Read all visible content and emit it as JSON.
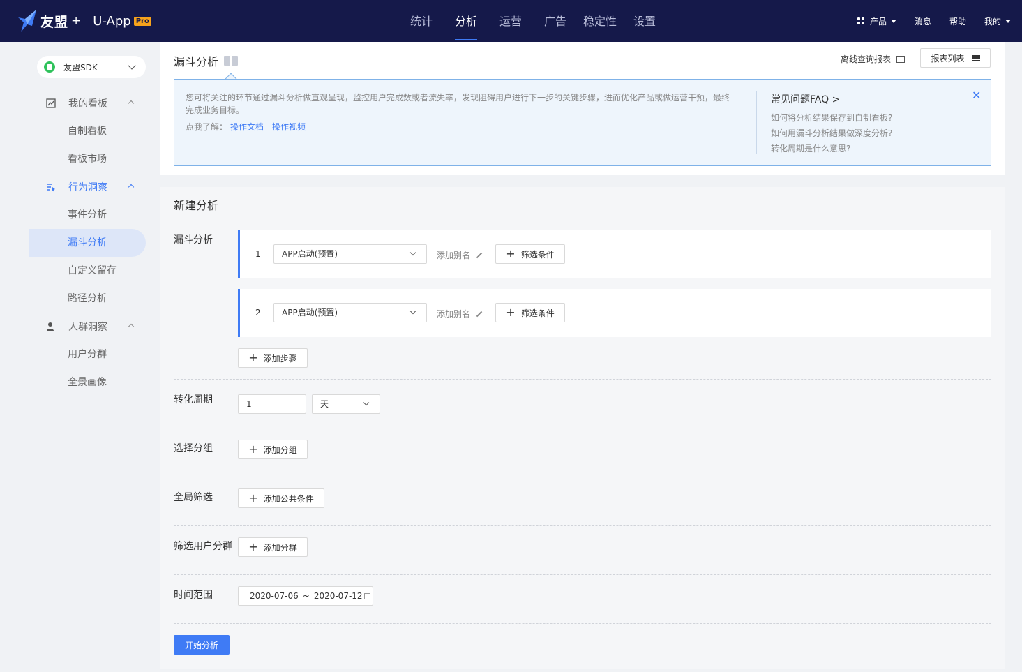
{
  "header": {
    "logo_text": "友盟",
    "logo_plus": "+",
    "logo_uapp": "U-App",
    "logo_pro": "Pro",
    "nav": [
      "统计",
      "分析",
      "运营",
      "广告",
      "稳定性",
      "设置"
    ],
    "active_nav": "分析",
    "right": {
      "product": "产品",
      "messages": "消息",
      "help": "帮助",
      "mine": "我的"
    }
  },
  "sidebar": {
    "app_selector": "友盟SDK",
    "groups": [
      {
        "label": "我的看板",
        "icon": "chart-icon",
        "items": [
          "自制看板",
          "看板市场"
        ]
      },
      {
        "label": "行为洞察",
        "icon": "behavior-icon",
        "items": [
          "事件分析",
          "漏斗分析",
          "自定义留存",
          "路径分析"
        ]
      },
      {
        "label": "人群洞察",
        "icon": "people-icon",
        "items": [
          "用户分群",
          "全景画像"
        ]
      }
    ],
    "active_item": "漏斗分析"
  },
  "top_panel": {
    "title": "漏斗分析",
    "offline_link": "离线查询报表",
    "report_list": "报表列表",
    "info": {
      "text": "您可将关注的环节通过漏斗分析做直观呈现，监控用户完成数或者流失率，发现阻碍用户进行下一步的关键步骤，进而优化产品或做运营干预，最终完成业务目标。",
      "learn_prefix": "点我了解：",
      "link_doc": "操作文档",
      "link_video": "操作视频"
    },
    "faq": {
      "title": "常见问题FAQ >",
      "questions": [
        "如何将分析结果保存到自制看板?",
        "如何用漏斗分析结果做深度分析?",
        "转化周期是什么意思?"
      ]
    }
  },
  "main_panel": {
    "title": "新建分析",
    "funnel": {
      "label": "漏斗分析",
      "steps": [
        {
          "num": "1",
          "event": "APP启动(预置)",
          "alias": "添加别名",
          "filter": "筛选条件"
        },
        {
          "num": "2",
          "event": "APP启动(预置)",
          "alias": "添加别名",
          "filter": "筛选条件"
        }
      ],
      "add_step": "添加步骤"
    },
    "period": {
      "label": "转化周期",
      "value": "1",
      "unit": "天"
    },
    "group": {
      "label": "选择分组",
      "button": "添加分组"
    },
    "global_filter": {
      "label": "全局筛选",
      "button": "添加公共条件"
    },
    "segment": {
      "label": "筛选用户分群",
      "button": "添加分群"
    },
    "time_range": {
      "label": "时间范围",
      "start": "2020-07-06",
      "sep": "~",
      "end": "2020-07-12"
    },
    "start_button": "开始分析"
  }
}
